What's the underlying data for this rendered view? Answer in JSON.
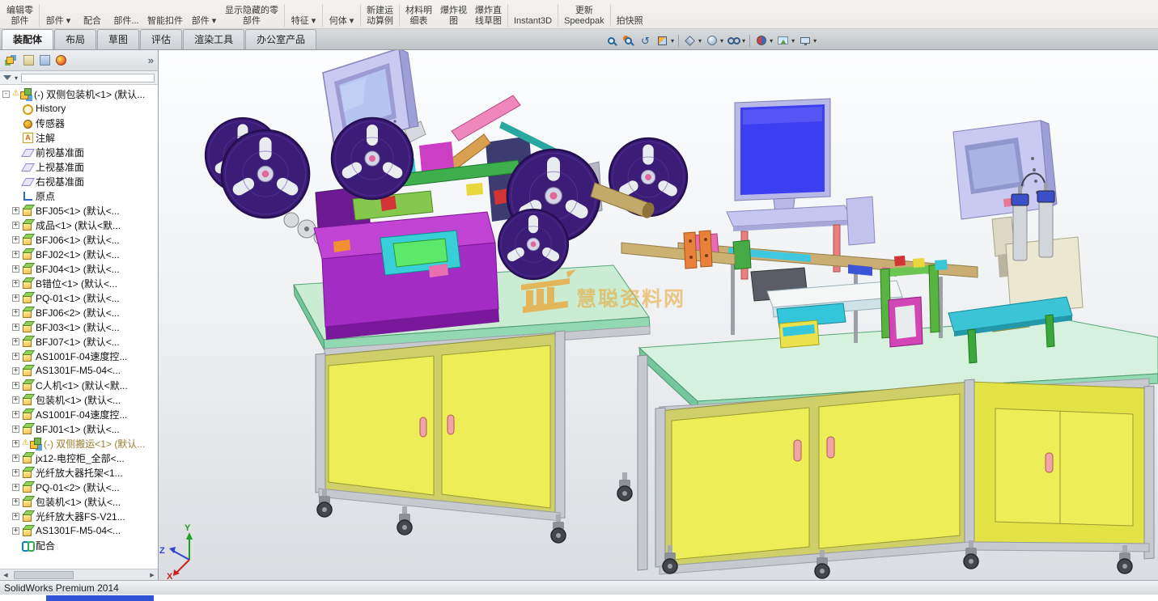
{
  "app": {
    "status": "SolidWorks Premium 2014"
  },
  "ribbon": {
    "buttons": [
      {
        "lines": [
          "编辑零",
          "部件"
        ]
      },
      {
        "lines": [
          "",
          "部件"
        ],
        "caret": true,
        "sep": true
      },
      {
        "lines": [
          "",
          "配合"
        ]
      },
      {
        "lines": [
          "",
          "部件..."
        ]
      },
      {
        "lines": [
          "",
          "智能扣件"
        ]
      },
      {
        "lines": [
          "",
          "部件"
        ],
        "caret": true
      },
      {
        "lines": [
          "显示隐藏的零",
          "部件"
        ]
      },
      {
        "lines": [
          "",
          "特征"
        ],
        "caret": true,
        "sep": true
      },
      {
        "lines": [
          "",
          "何体"
        ],
        "caret": true,
        "sep": true
      },
      {
        "lines": [
          "新建运",
          "动算例"
        ],
        "sep": true
      },
      {
        "lines": [
          "材料明",
          "细表"
        ],
        "sep": true
      },
      {
        "lines": [
          "爆炸视",
          "图"
        ]
      },
      {
        "lines": [
          "爆炸直",
          "线草图"
        ]
      },
      {
        "lines": [
          "Instant3D"
        ],
        "sep": true
      },
      {
        "lines": [
          "更新",
          "Speedpak"
        ],
        "sep": true
      },
      {
        "lines": [
          "拍快照"
        ],
        "sep": true
      }
    ],
    "tabs": [
      {
        "label": "装配体",
        "active": true
      },
      {
        "label": "布局"
      },
      {
        "label": "草图"
      },
      {
        "label": "评估"
      },
      {
        "label": "渲染工具"
      },
      {
        "label": "办公室产品"
      }
    ]
  },
  "headsup": {
    "items": [
      {
        "name": "zoom-fit",
        "cls": "mag"
      },
      {
        "name": "zoom-area",
        "cls": "magarea"
      },
      {
        "name": "previous-view",
        "cls": "prev"
      },
      {
        "name": "section-view",
        "cls": "sect",
        "caret": true
      },
      {
        "name": "view-orientation",
        "cls": "cube",
        "caret": true,
        "sep": true
      },
      {
        "name": "display-style",
        "cls": "sphere",
        "caret": true
      },
      {
        "name": "hide-show-items",
        "cls": "glass",
        "caret": true
      },
      {
        "name": "edit-appearance",
        "cls": "ball",
        "caret": true,
        "sep": true
      },
      {
        "name": "apply-scene",
        "cls": "scene",
        "caret": true
      },
      {
        "name": "view-settings",
        "cls": "mon",
        "caret": true
      }
    ]
  },
  "panel": {
    "expand_label": "»",
    "filter_placeholder": ""
  },
  "tree": {
    "items": [
      {
        "label": "(-) 双侧包装机<1> (默认...",
        "type": "assembly",
        "expand": "open",
        "warn": true
      },
      {
        "label": "History",
        "type": "history",
        "indent": 1
      },
      {
        "label": "传感器",
        "type": "sensors",
        "indent": 1
      },
      {
        "label": "注解",
        "type": "annotations",
        "indent": 1
      },
      {
        "label": "前视基准面",
        "type": "plane",
        "indent": 1
      },
      {
        "label": "上视基准面",
        "type": "plane",
        "indent": 1
      },
      {
        "label": "右视基准面",
        "type": "plane",
        "indent": 1
      },
      {
        "label": "原点",
        "type": "origin",
        "indent": 1
      },
      {
        "label": "BFJ05<1> (默认<...",
        "type": "component",
        "expand": "closed",
        "indent": 1
      },
      {
        "label": "成品<1> (默认<默...",
        "type": "component",
        "expand": "closed",
        "indent": 1
      },
      {
        "label": "BFJ06<1> (默认<...",
        "type": "component",
        "expand": "closed",
        "indent": 1
      },
      {
        "label": "BFJ02<1> (默认<...",
        "type": "component",
        "expand": "closed",
        "indent": 1
      },
      {
        "label": "BFJ04<1> (默认<...",
        "type": "component",
        "expand": "closed",
        "indent": 1
      },
      {
        "label": "B错位<1> (默认<...",
        "type": "component",
        "expand": "closed",
        "indent": 1
      },
      {
        "label": "PQ-01<1> (默认<...",
        "type": "component",
        "expand": "closed",
        "indent": 1
      },
      {
        "label": "BFJ06<2> (默认<...",
        "type": "component",
        "expand": "closed",
        "indent": 1
      },
      {
        "label": "BFJ03<1> (默认<...",
        "type": "component",
        "expand": "closed",
        "indent": 1
      },
      {
        "label": "BFJ07<1> (默认<...",
        "type": "component",
        "expand": "closed",
        "indent": 1
      },
      {
        "label": "AS1001F-04速度控...",
        "type": "component",
        "expand": "closed",
        "indent": 1
      },
      {
        "label": "AS1301F-M5-04<...",
        "type": "component",
        "expand": "closed",
        "indent": 1
      },
      {
        "label": "C人机<1> (默认<默...",
        "type": "component",
        "expand": "closed",
        "indent": 1
      },
      {
        "label": "包装机<1> (默认<...",
        "type": "component",
        "expand": "closed",
        "indent": 1
      },
      {
        "label": "AS1001F-04速度控...",
        "type": "component",
        "expand": "closed",
        "indent": 1
      },
      {
        "label": "BFJ01<1> (默认<...",
        "type": "component",
        "expand": "closed",
        "indent": 1
      },
      {
        "label": "(-) 双侧搬运<1> (默认...",
        "type": "assembly",
        "expand": "closed",
        "warn": true,
        "color": "#9a7d2e",
        "indent": 1
      },
      {
        "label": "jx12-电控柜_全部<...",
        "type": "component",
        "expand": "closed",
        "indent": 1
      },
      {
        "label": "光纤放大器托架<1...",
        "type": "component",
        "expand": "closed",
        "indent": 1
      },
      {
        "label": "PQ-01<2> (默认<...",
        "type": "component",
        "expand": "closed",
        "indent": 1
      },
      {
        "label": "包装机<1> (默认<...",
        "type": "component",
        "expand": "closed",
        "indent": 1
      },
      {
        "label": "光纤放大器FS-V21...",
        "type": "component",
        "expand": "closed",
        "indent": 1
      },
      {
        "label": "AS1301F-M5-04<...",
        "type": "component",
        "expand": "closed",
        "indent": 1
      },
      {
        "label": "配合",
        "type": "mates",
        "indent": 1
      }
    ]
  },
  "watermark": {
    "text": "慧聪资料网"
  },
  "triad": {
    "x": "X",
    "y": "Y",
    "z": "Z"
  },
  "colors": {
    "table_top_green": "#c9ecd2",
    "cabinet_yellow": "#eded58",
    "reel_purple": "#3b1d77",
    "machine_magenta": "#a22cc4",
    "monitor_screen_blue": "#3d3df2",
    "handle_pink": "#f2a5a5"
  }
}
